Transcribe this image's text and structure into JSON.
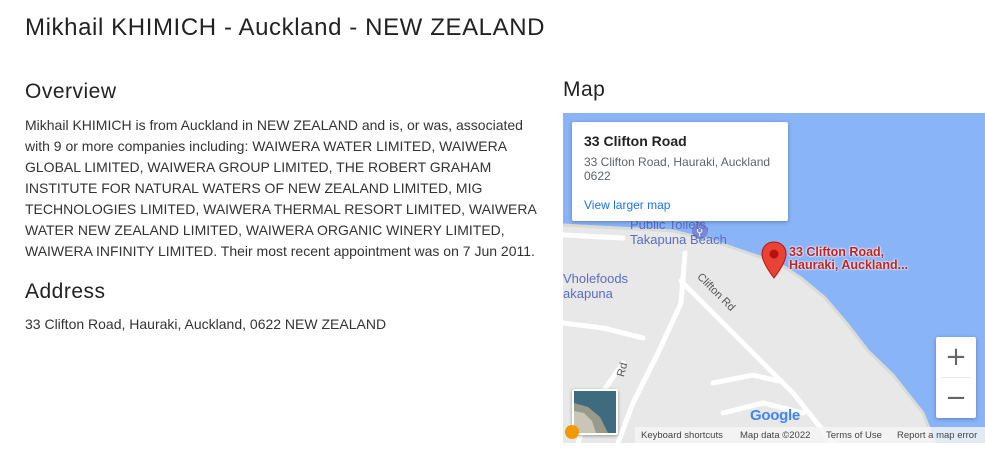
{
  "header": {
    "title": "Mikhail KHIMICH - Auckland - NEW ZEALAND"
  },
  "overview": {
    "heading": "Overview",
    "text": "Mikhail KHIMICH is from Auckland in NEW ZEALAND and is, or was, associated with 9 or more companies including: WAIWERA WATER LIMITED, WAIWERA GLOBAL LIMITED, WAIWERA GROUP LIMITED, THE ROBERT GRAHAM INSTITUTE FOR NATURAL WATERS OF NEW ZEALAND LIMITED, MIG TECHNOLOGIES LIMITED, WAIWERA THERMAL RESORT LIMITED, WAIWERA WATER NEW ZEALAND LIMITED, WAIWERA ORGANIC WINERY LIMITED, WAIWERA INFINITY LIMITED. Their most recent appointment was on 7 Jun 2011."
  },
  "address": {
    "heading": "Address",
    "text": "33 Clifton Road, Hauraki, Auckland, 0622 NEW ZEALAND"
  },
  "map": {
    "heading": "Map",
    "info_card": {
      "title": "33 Clifton Road",
      "address": "33 Clifton Road, Hauraki, Auckland 0622",
      "link": "View larger map"
    },
    "marker_label_line1": "33 Clifton Road,",
    "marker_label_line2": "Hauraki, Auckland...",
    "poi_toilets_1": "Public Toilets,",
    "poi_toilets_2": "Takapuna Beach",
    "poi_wholefoods_1": "Vholefoods",
    "poi_wholefoods_2": "akapuna",
    "road_clifton": "Clifton Rd",
    "road_other": "Rd",
    "zoom_in": "+",
    "zoom_out": "−",
    "logo": "Google",
    "footer": {
      "shortcuts": "Keyboard shortcuts",
      "data": "Map data ©2022",
      "terms": "Terms of Use",
      "report": "Report a map error"
    },
    "colors": {
      "water": "#8ab4f8",
      "land": "#e8e8e8",
      "road": "#ffffff",
      "marker": "#ea4335",
      "link": "#1a73e8"
    }
  }
}
